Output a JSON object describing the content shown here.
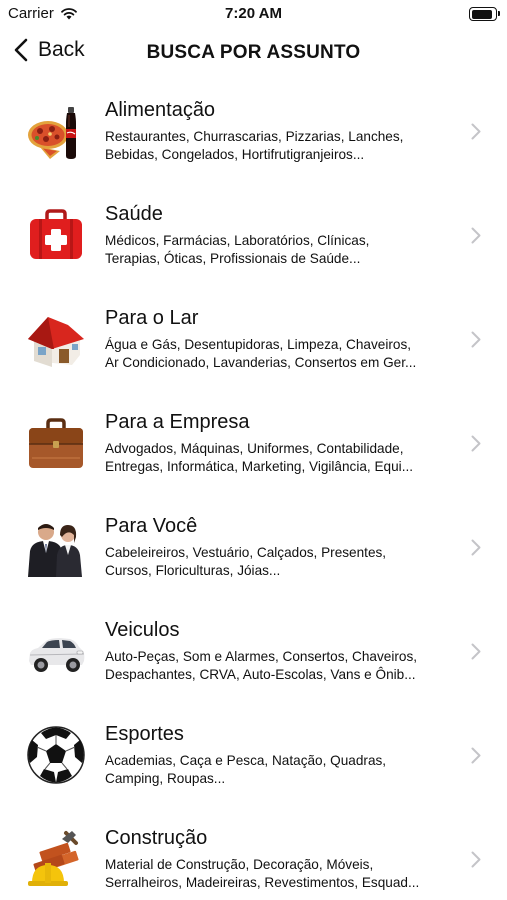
{
  "status_bar": {
    "carrier": "Carrier",
    "time": "7:20 AM",
    "battery_level": 0.9
  },
  "nav": {
    "back_label": "Back",
    "title": "BUSCA POR ASSUNTO"
  },
  "categories": [
    {
      "icon": "food-icon",
      "title": "Alimentação",
      "line1": "Restaurantes, Churrascarias, Pizzarias, Lanches,",
      "line2": "Bebidas, Congelados, Hortifrutigranjeiros..."
    },
    {
      "icon": "first-aid-kit-icon",
      "title": "Saúde",
      "line1": "Médicos, Farmácias, Laboratórios, Clínicas,",
      "line2": "Terapias, Óticas, Profissionais de Saúde..."
    },
    {
      "icon": "house-icon",
      "title": "Para o Lar",
      "line1": "Água e Gás, Desentupidoras, Limpeza, Chaveiros,",
      "line2": "Ar Condicionado, Lavanderias, Consertos em Ger..."
    },
    {
      "icon": "briefcase-icon",
      "title": "Para a Empresa",
      "line1": "Advogados, Máquinas, Uniformes, Contabilidade,",
      "line2": "Entregas, Informática, Marketing, Vigilância, Equi..."
    },
    {
      "icon": "people-icon",
      "title": "Para Você",
      "line1": "Cabeleireiros, Vestuário, Calçados, Presentes,",
      "line2": "Cursos, Floriculturas, Jóias..."
    },
    {
      "icon": "car-icon",
      "title": "Veiculos",
      "line1": "Auto-Peças, Som e Alarmes, Consertos, Chaveiros,",
      "line2": "Despachantes, CRVA, Auto-Escolas, Vans e Ônib..."
    },
    {
      "icon": "soccer-ball-icon",
      "title": "Esportes",
      "line1": "Academias, Caça e Pesca, Natação, Quadras,",
      "line2": "Camping, Roupas..."
    },
    {
      "icon": "construction-icon",
      "title": "Construção",
      "line1": "Material de Construção, Decoração, Móveis,",
      "line2": "Serralheiros, Madeireiras, Revestimentos, Esquad..."
    }
  ]
}
